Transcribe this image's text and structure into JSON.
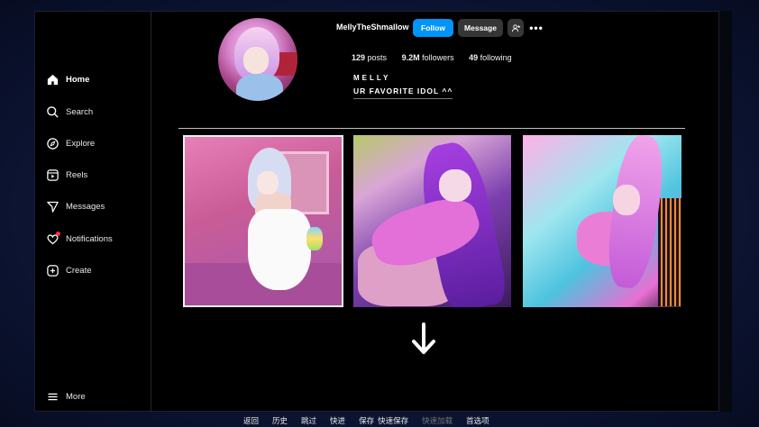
{
  "sidebar": {
    "items": [
      {
        "label": "Home",
        "icon": "home-icon",
        "active": true
      },
      {
        "label": "Search",
        "icon": "search-icon",
        "active": false
      },
      {
        "label": "Explore",
        "icon": "compass-icon",
        "active": false
      },
      {
        "label": "Reels",
        "icon": "reels-icon",
        "active": false
      },
      {
        "label": "Messages",
        "icon": "send-icon",
        "active": false
      },
      {
        "label": "Notifications",
        "icon": "heart-icon",
        "active": false
      },
      {
        "label": "Create",
        "icon": "plus-square-icon",
        "active": false
      }
    ],
    "more_label": "More"
  },
  "profile": {
    "username": "MellyTheShmallow",
    "follow_label": "Follow",
    "message_label": "Message",
    "add_user_icon": "add-user-icon",
    "more_icon": "more-horizontal-icon",
    "stats": {
      "posts_count": "129",
      "posts_label": "posts",
      "followers_count": "9.2M",
      "followers_label": "followers",
      "following_count": "49",
      "following_label": "following"
    },
    "full_name": "MELLY",
    "bio": "UR FAVORITE IDOL ^^"
  },
  "posts": [
    {
      "selected": true
    },
    {
      "selected": false
    },
    {
      "selected": false
    }
  ],
  "game_menu": {
    "items": [
      "返回",
      "历史",
      "跳过",
      "快进",
      "保存",
      "快速保存",
      "快速加载",
      "首选项"
    ],
    "disabled_index": 6
  },
  "colors": {
    "follow_button": "#0095f6",
    "secondary_button": "#363636",
    "background": "#000000",
    "frame": "#0b1330"
  }
}
